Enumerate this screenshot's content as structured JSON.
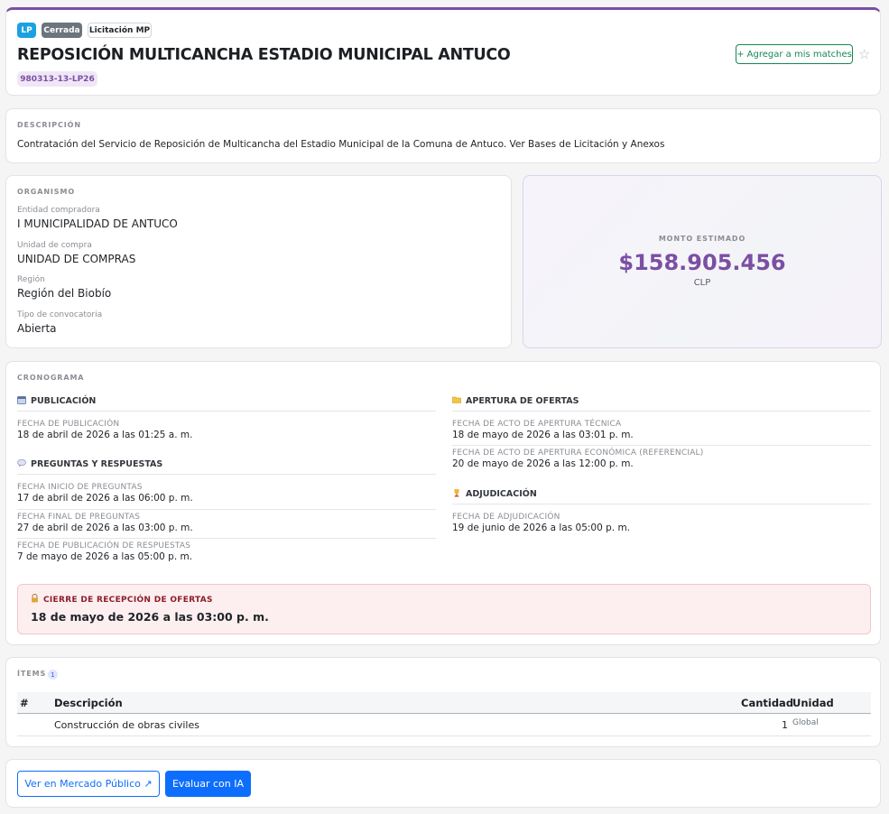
{
  "header": {
    "badges": {
      "type": "LP",
      "status": "Cerrada",
      "source": "Licitación MP"
    },
    "title": "REPOSICIÓN MULTICANCHA ESTADIO MUNICIPAL ANTUCO",
    "code": "980313-13-LP26",
    "match_button": "+ Agregar a mis matches",
    "star_icon": "☆"
  },
  "description": {
    "label": "DESCRIPCIÓN",
    "text": "Contratación del Servicio de Reposición de Multicancha del Estadio Municipal de la Comuna de Antuco. Ver Bases de Licitación y Anexos"
  },
  "organismo": {
    "label": "ORGANISMO",
    "fields": [
      {
        "label": "Entidad compradora",
        "value": "I MUNICIPALIDAD DE ANTUCO"
      },
      {
        "label": "Unidad de compra",
        "value": "UNIDAD DE COMPRAS"
      },
      {
        "label": "Región",
        "value": "Región del Biobío"
      },
      {
        "label": "Tipo de convocatoria",
        "value": "Abierta"
      }
    ]
  },
  "monto": {
    "label": "MONTO ESTIMADO",
    "value": "$158.905.456",
    "currency": "CLP"
  },
  "cronograma": {
    "label": "CRONOGRAMA",
    "publicacion": {
      "title": "PUBLICACIÓN",
      "icon": "calendar-icon",
      "items": [
        {
          "label": "FECHA DE PUBLICACIÓN",
          "date": "18 de abril de 2026 a las 01:25 a. m."
        }
      ]
    },
    "preguntas": {
      "title": "PREGUNTAS Y RESPUESTAS",
      "icon": "speech-bubble-icon",
      "items": [
        {
          "label": "FECHA INICIO DE PREGUNTAS",
          "date": "17 de abril de 2026 a las 06:00 p. m."
        },
        {
          "label": "FECHA FINAL DE PREGUNTAS",
          "date": "27 de abril de 2026 a las 03:00 p. m."
        },
        {
          "label": "FECHA DE PUBLICACIÓN DE RESPUESTAS",
          "date": "7 de mayo de 2026 a las 05:00 p. m."
        }
      ]
    },
    "apertura": {
      "title": "APERTURA DE OFERTAS",
      "icon": "folder-icon",
      "items": [
        {
          "label": "FECHA DE ACTO DE APERTURA TÉCNICA",
          "date": "18 de mayo de 2026 a las 03:01 p. m."
        },
        {
          "label": "FECHA DE ACTO DE APERTURA ECONÓMICA (REFERENCIAL)",
          "date": "20 de mayo de 2026 a las 12:00 p. m."
        }
      ]
    },
    "adjudicacion": {
      "title": "ADJUDICACIÓN",
      "icon": "trophy-icon",
      "items": [
        {
          "label": "FECHA DE ADJUDICACIÓN",
          "date": "19 de junio de 2026 a las 05:00 p. m."
        }
      ]
    },
    "cierre": {
      "label": "CIERRE DE RECEPCIÓN DE OFERTAS",
      "icon": "lock-icon",
      "date": "18 de mayo de 2026 a las 03:00 p. m."
    }
  },
  "items": {
    "label": "ÍTEMS",
    "count": "1",
    "columns": [
      "#",
      "Descripción",
      "Cantidad",
      "Unidad"
    ],
    "rows": [
      {
        "num": "",
        "description": "Construcción de obras civiles",
        "quantity": "1",
        "unit": "Global"
      }
    ]
  },
  "actions": {
    "mercado_publico": "Ver en Mercado Público ↗",
    "evaluar_ia": "Evaluar con IA"
  },
  "colors": {
    "accent": "#7b4fa3",
    "primary": "#0d6efd",
    "success": "#198754",
    "lp_badge": "#1ba1e2",
    "closed_badge": "#6c757d"
  }
}
